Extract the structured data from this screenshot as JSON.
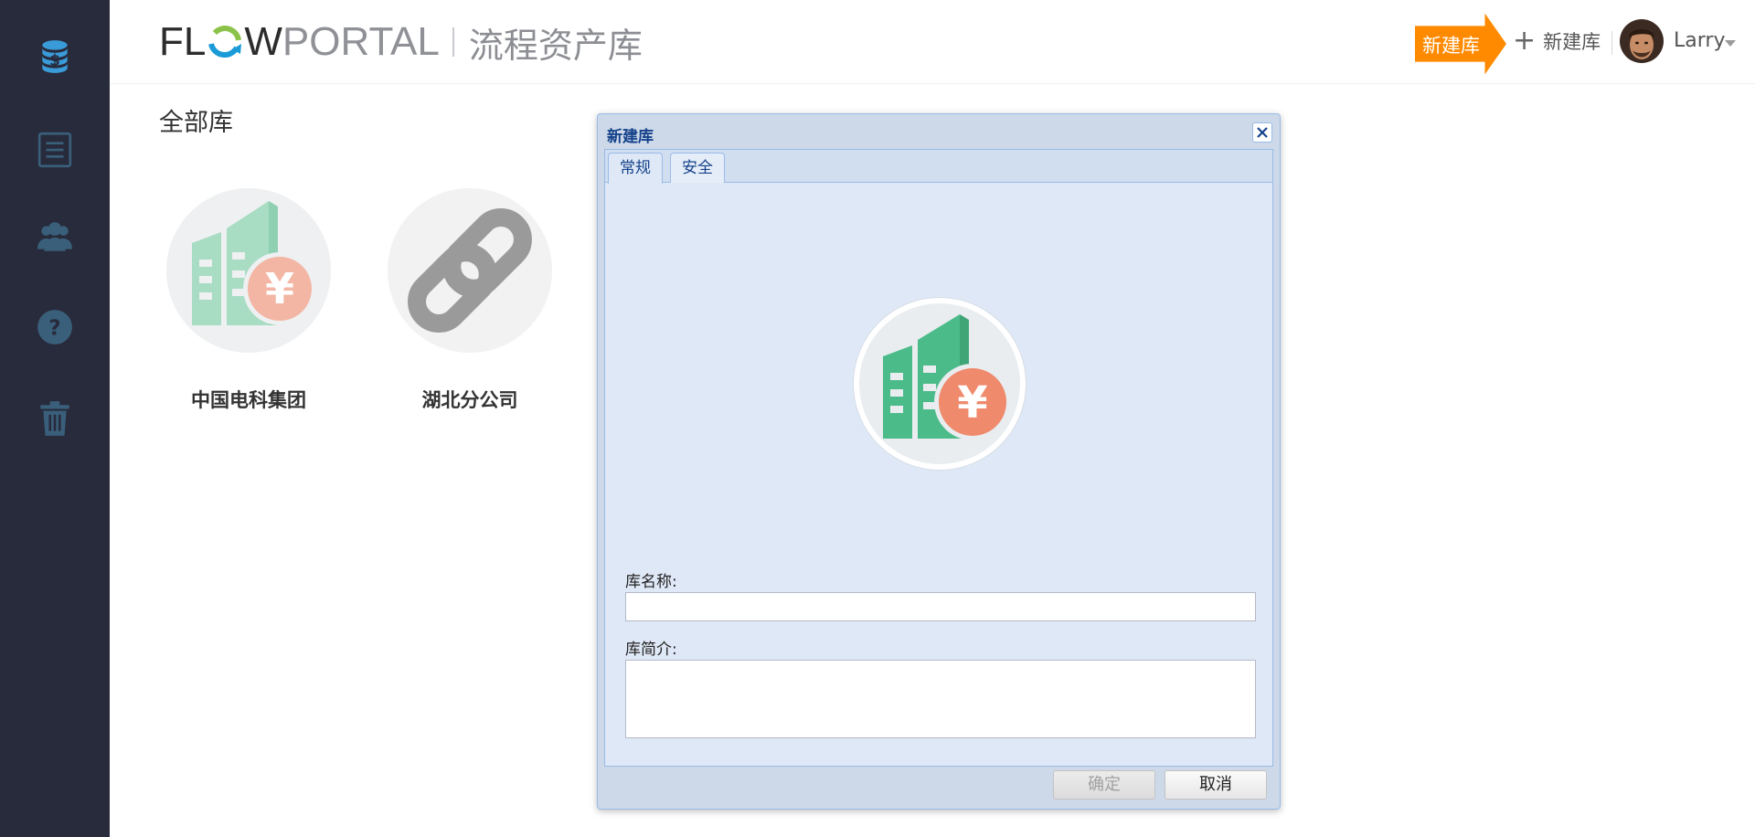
{
  "sidebar": {
    "items": [
      {
        "icon": "database-dollar-icon"
      },
      {
        "icon": "list-icon"
      },
      {
        "icon": "users-icon"
      },
      {
        "icon": "help-icon"
      },
      {
        "icon": "trash-icon"
      }
    ],
    "accent": "#3a9bd9"
  },
  "header": {
    "logo": {
      "flow": "FL",
      "flow_end": "WPORTAL",
      "brand_portal": "PORTAL",
      "subtitle": "流程资产库"
    },
    "tooltip": "新建库",
    "new_lib_label": "新建库",
    "user_name": "Larry"
  },
  "main": {
    "title": "全部库",
    "libraries": [
      {
        "name": "中国电科集团"
      },
      {
        "name": "湖北分公司"
      }
    ]
  },
  "dialog": {
    "title": "新建库",
    "tabs": [
      {
        "label": "常规"
      },
      {
        "label": "安全"
      }
    ],
    "name_label": "库名称:",
    "name_value": "",
    "desc_label": "库简介:",
    "desc_value": "",
    "ok_label": "确定",
    "cancel_label": "取消"
  },
  "colors": {
    "sidebar_bg": "#282b3c",
    "tooltip_orange": "#ff8a00",
    "building_green": "#4cbb8a",
    "yen_orange": "#ef8a6c",
    "dialog_title": "#15428b"
  }
}
